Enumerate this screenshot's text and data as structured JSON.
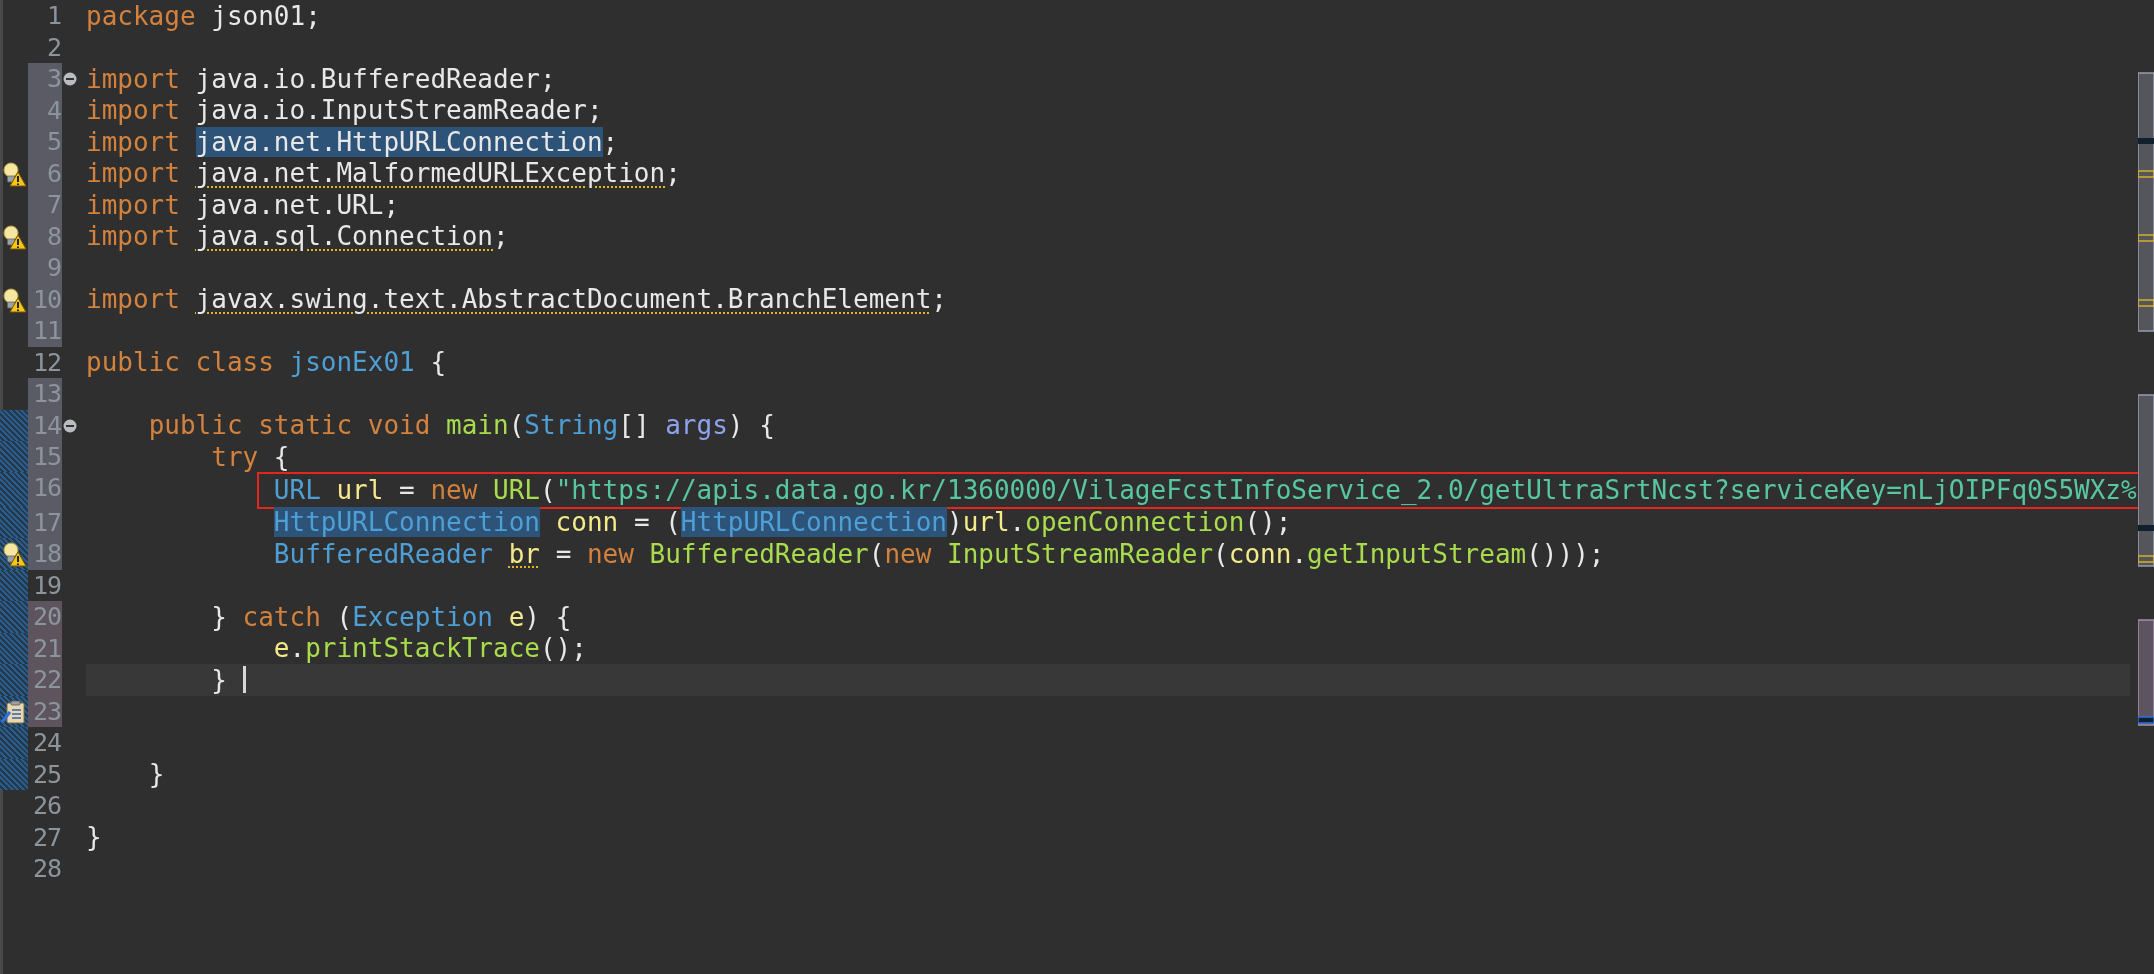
{
  "editor": {
    "lines": [
      {
        "number": "1",
        "fold": false,
        "hatch": false,
        "warning": false,
        "tokens": [
          {
            "text": "package ",
            "kind": "keyword"
          },
          {
            "text": "json01;",
            "kind": "plain"
          }
        ]
      },
      {
        "number": "2",
        "fold": false,
        "hatch": false,
        "warning": false
      },
      {
        "number": "3",
        "color": "#5b5b66",
        "fold": true,
        "hatch": false,
        "warning": false,
        "tokens": [
          {
            "text": "import ",
            "kind": "keyword"
          },
          {
            "text": "java.io.BufferedReader;",
            "kind": "plain"
          }
        ]
      },
      {
        "number": "4",
        "color": "#5b5b66",
        "fold": false,
        "hatch": false,
        "warning": false,
        "tokens": [
          {
            "text": "import ",
            "kind": "keyword"
          },
          {
            "text": "java.io.InputStreamReader;",
            "kind": "plain"
          }
        ]
      },
      {
        "number": "5",
        "color": "#5b5b66",
        "fold": false,
        "hatch": false,
        "warning": false,
        "tokens": [
          {
            "text": "import ",
            "kind": "keyword"
          },
          {
            "text": "java.net.HttpURLConnection",
            "kind": "plain",
            "highlighted": true
          },
          {
            "text": ";",
            "kind": "plain"
          }
        ]
      },
      {
        "number": "6",
        "color": "#5b5b66",
        "fold": false,
        "hatch": false,
        "warning": true,
        "tokens": [
          {
            "text": "import ",
            "kind": "keyword"
          },
          {
            "text": "java.net.MalformedURLException",
            "kind": "plain",
            "underlined": true
          },
          {
            "text": ";",
            "kind": "plain"
          }
        ]
      },
      {
        "number": "7",
        "color": "#5b5b66",
        "fold": false,
        "hatch": false,
        "warning": false,
        "tokens": [
          {
            "text": "import ",
            "kind": "keyword"
          },
          {
            "text": "java.net.URL;",
            "kind": "plain"
          }
        ]
      },
      {
        "number": "8",
        "color": "#5b5b66",
        "fold": false,
        "hatch": false,
        "warning": true,
        "tokens": [
          {
            "text": "import ",
            "kind": "keyword"
          },
          {
            "text": "java.sql.Connection",
            "kind": "plain",
            "underlined": true
          },
          {
            "text": ";",
            "kind": "plain"
          }
        ]
      },
      {
        "number": "9",
        "color": "#5b5b66",
        "fold": false,
        "hatch": false,
        "warning": false
      },
      {
        "number": "10",
        "color": "#5b5b66",
        "fold": false,
        "hatch": false,
        "warning": true,
        "tokens": [
          {
            "text": "import ",
            "kind": "keyword"
          },
          {
            "text": "javax.swing.text.AbstractDocument.BranchElement",
            "kind": "plain",
            "underlined": true
          },
          {
            "text": ";",
            "kind": "plain"
          }
        ]
      },
      {
        "number": "11",
        "color": "#5b5b66",
        "fold": false,
        "hatch": false,
        "warning": false
      },
      {
        "number": "12",
        "fold": false,
        "hatch": false,
        "warning": false,
        "tokens": [
          {
            "text": "public class ",
            "kind": "keyword"
          },
          {
            "text": "jsonEx01",
            "kind": "type"
          },
          {
            "text": " {",
            "kind": "plain"
          }
        ]
      },
      {
        "number": "13",
        "color": "#5b5b66",
        "fold": false,
        "hatch": false,
        "warning": false
      },
      {
        "number": "14",
        "color": "#5b5b66",
        "fold": true,
        "hatch": true,
        "warning": false,
        "tokens": [
          {
            "text": "    public static void ",
            "kind": "keyword"
          },
          {
            "text": "main",
            "kind": "method"
          },
          {
            "text": "(",
            "kind": "plain"
          },
          {
            "text": "String",
            "kind": "type"
          },
          {
            "text": "[] ",
            "kind": "plain"
          },
          {
            "text": "args",
            "kind": "parameter"
          },
          {
            "text": ") {",
            "kind": "plain"
          }
        ]
      },
      {
        "number": "15",
        "color": "#5b5b66",
        "fold": false,
        "hatch": true,
        "warning": false,
        "tokens": [
          {
            "text": "        try",
            "kind": "keyword"
          },
          {
            "text": " {",
            "kind": "plain"
          }
        ]
      },
      {
        "number": "16",
        "color": "#5b5b66",
        "fold": false,
        "hatch": true,
        "warning": false,
        "boxed": true,
        "tokens": [
          {
            "text": "            URL ",
            "kind": "type"
          },
          {
            "text": "url",
            "kind": "variable"
          },
          {
            "text": " = ",
            "kind": "plain"
          },
          {
            "text": "new ",
            "kind": "keyword"
          },
          {
            "text": "URL",
            "kind": "method"
          },
          {
            "text": "(",
            "kind": "plain"
          },
          {
            "text": "\"https://apis.data.go.kr/1360000/VilageFcstInfoService_2.0/getUltraSrtNcst?serviceKey=nLjOIPFq0S5WXz%",
            "kind": "string"
          }
        ]
      },
      {
        "number": "17",
        "color": "#5b5b66",
        "fold": false,
        "hatch": true,
        "warning": false,
        "tokens": [
          {
            "text": "            HttpURLConnection",
            "kind": "type",
            "highlighted": true
          },
          {
            "text": " conn",
            "kind": "variable"
          },
          {
            "text": " = (",
            "kind": "plain"
          },
          {
            "text": "HttpURLConnection",
            "kind": "type",
            "highlighted": true
          },
          {
            "text": ")",
            "kind": "plain"
          },
          {
            "text": "url",
            "kind": "variable"
          },
          {
            "text": ".",
            "kind": "plain"
          },
          {
            "text": "openConnection",
            "kind": "method"
          },
          {
            "text": "();",
            "kind": "plain"
          }
        ]
      },
      {
        "number": "18",
        "color": "#5b5b66",
        "fold": false,
        "hatch": true,
        "warning": true,
        "tokens": [
          {
            "text": "            BufferedReader ",
            "kind": "type"
          },
          {
            "text": "br",
            "kind": "variable",
            "underlined": true
          },
          {
            "text": " = ",
            "kind": "plain"
          },
          {
            "text": "new ",
            "kind": "keyword"
          },
          {
            "text": "BufferedReader",
            "kind": "method"
          },
          {
            "text": "(",
            "kind": "plain"
          },
          {
            "text": "new ",
            "kind": "keyword"
          },
          {
            "text": "InputStreamReader",
            "kind": "method"
          },
          {
            "text": "(",
            "kind": "plain"
          },
          {
            "text": "conn",
            "kind": "variable"
          },
          {
            "text": ".",
            "kind": "plain"
          },
          {
            "text": "getInputStream",
            "kind": "method"
          },
          {
            "text": "()));",
            "kind": "plain"
          }
        ]
      },
      {
        "number": "19",
        "fold": false,
        "hatch": true,
        "warning": false
      },
      {
        "number": "20",
        "color": "#5e545e",
        "fold": false,
        "hatch": true,
        "warning": false,
        "tokens": [
          {
            "text": "        } ",
            "kind": "plain"
          },
          {
            "text": "catch",
            "kind": "keyword"
          },
          {
            "text": " (",
            "kind": "plain"
          },
          {
            "text": "Exception ",
            "kind": "type"
          },
          {
            "text": "e",
            "kind": "variable"
          },
          {
            "text": ") {",
            "kind": "plain"
          }
        ]
      },
      {
        "number": "21",
        "color": "#5e545e",
        "fold": false,
        "hatch": true,
        "warning": false,
        "tokens": [
          {
            "text": "            e",
            "kind": "variable"
          },
          {
            "text": ".",
            "kind": "plain"
          },
          {
            "text": "printStackTrace",
            "kind": "method"
          },
          {
            "text": "();",
            "kind": "plain"
          }
        ]
      },
      {
        "number": "22",
        "color": "#5e545e",
        "fold": false,
        "hatch": true,
        "warning": false,
        "current": true,
        "cursor": true,
        "tokens": [
          {
            "text": "        } ",
            "kind": "plain"
          }
        ]
      },
      {
        "number": "23",
        "color": "#5e545e",
        "fold": false,
        "hatch": true,
        "warning": false,
        "task": true
      },
      {
        "number": "24",
        "fold": false,
        "hatch": true,
        "warning": false
      },
      {
        "number": "25",
        "fold": false,
        "hatch": true,
        "warning": false,
        "tokens": [
          {
            "text": "    }",
            "kind": "plain"
          }
        ]
      },
      {
        "number": "26",
        "fold": false,
        "hatch": false,
        "warning": false
      },
      {
        "number": "27",
        "fold": false,
        "hatch": false,
        "warning": false,
        "tokens": [
          {
            "text": "}",
            "kind": "plain"
          }
        ]
      },
      {
        "number": "28",
        "fold": false,
        "hatch": false,
        "warning": false
      }
    ]
  }
}
